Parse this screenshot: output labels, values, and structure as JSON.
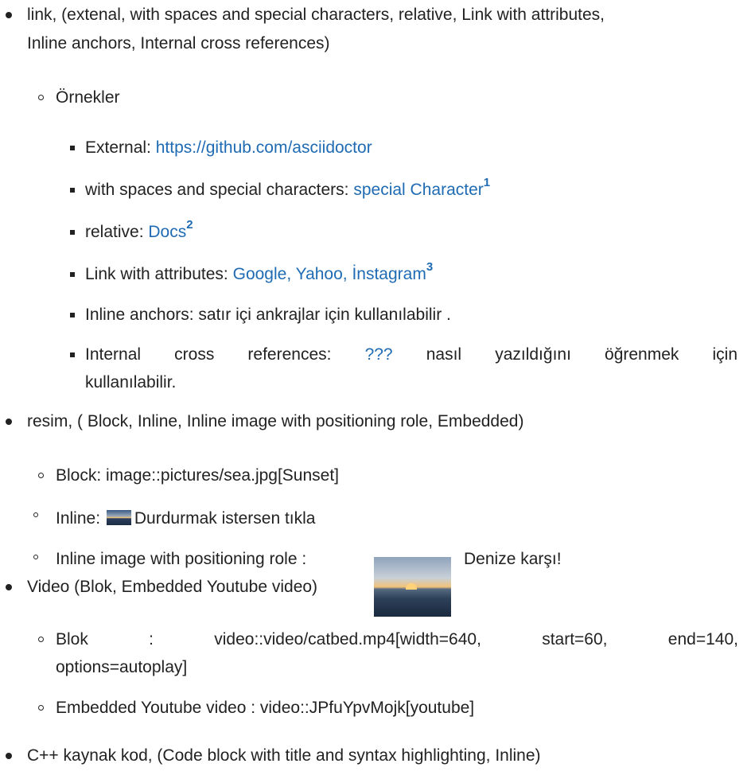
{
  "list": {
    "item1": {
      "line1": "link, (extenal, with spaces and special characters, relative, Link with attributes,",
      "line2": "Inline anchors, Internal cross references)",
      "sub_label": "Örnekler",
      "external_label": "External:",
      "external_link": "https://github.com/asciidoctor",
      "special_label": "with spaces and special characters:",
      "special_link": "special Character",
      "special_note": "1",
      "relative_label": "relative:",
      "relative_link": "Docs",
      "relative_note": "2",
      "attrs_label": "Link with attributes:",
      "attrs_link": "Google, Yahoo, İnstagram",
      "attrs_note": "3",
      "anchors_text": "Inline anchors: satır içi ankrajlar için kullanılabilir .",
      "xref_prefix": "Internal cross references:",
      "xref_link": "???",
      "xref_suffix": "nasıl yazıldığını öğrenmek için",
      "xref_line2": "kullanılabilir."
    },
    "item2": {
      "line1": "resim, ( Block, Inline, Inline image with positioning role, Embedded)",
      "block_text": "Block: image::pictures/sea.jpg[Sunset]",
      "inline_label": "Inline:",
      "inline_text": "Durdurmak istersen tıkla",
      "positioning_label": "Inline image with positioning role :",
      "positioning_text": "Denize karşı!"
    },
    "item3": {
      "line1": "Video (Blok, Embedded Youtube video)",
      "blok_label": "Blok",
      "blok_colon": ":",
      "blok_part1": "video::video/catbed.mp4[width=640,",
      "blok_part2": "start=60,",
      "blok_part3": "end=140,",
      "blok_line2": "options=autoplay]",
      "embedded_text": "Embedded Youtube video : video::JPfuYpvMojk[youtube]"
    },
    "item4": {
      "line1": "C++ kaynak kod, (Code block with title and syntax highlighting, Inline)"
    }
  }
}
